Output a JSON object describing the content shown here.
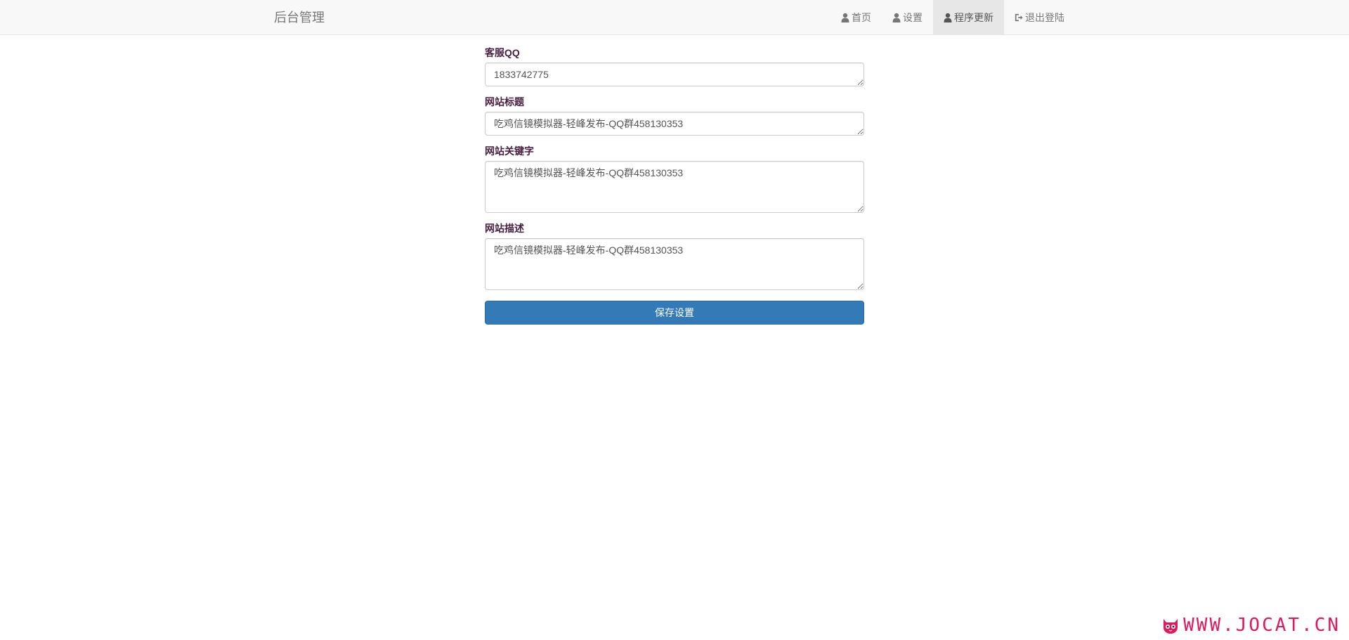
{
  "navbar": {
    "brand": "后台管理",
    "items": [
      {
        "label": "首页",
        "icon": "user-icon",
        "active": false
      },
      {
        "label": "设置",
        "icon": "user-icon",
        "active": false
      },
      {
        "label": "程序更新",
        "icon": "user-icon",
        "active": true
      },
      {
        "label": "退出登陆",
        "icon": "logout-icon",
        "active": false
      }
    ]
  },
  "form": {
    "qq_label": "客服QQ",
    "qq_value": "1833742775",
    "title_label": "网站标题",
    "title_value": "吃鸡信镜模拟器-轻峰发布-QQ群458130353",
    "keywords_label": "网站关键字",
    "keywords_value": "吃鸡信镜模拟器-轻峰发布-QQ群458130353",
    "description_label": "网站描述",
    "description_value": "吃鸡信镜模拟器-轻峰发布-QQ群458130353",
    "save_label": "保存设置"
  },
  "watermark": {
    "text": "WWW.JOCAT.CN",
    "color": "#e0185f"
  },
  "colors": {
    "primary": "#337ab7",
    "navbar_bg": "#f8f8f8",
    "active_tab_bg": "#e7e7e7"
  }
}
